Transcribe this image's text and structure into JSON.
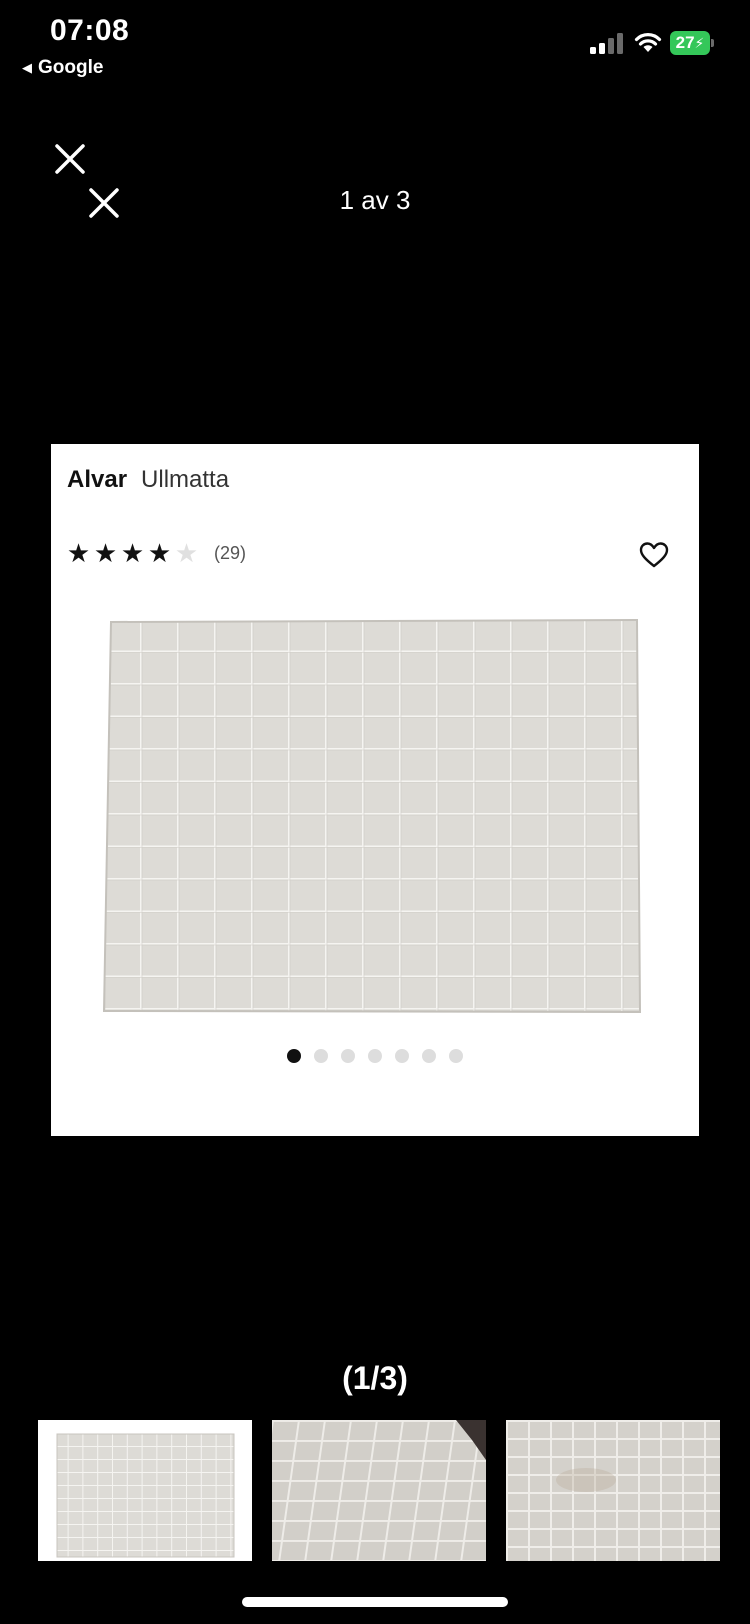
{
  "status_bar": {
    "time": "07:08",
    "back_label": "Google",
    "battery": "27"
  },
  "viewer": {
    "counter_top": "1 av 3",
    "counter_bottom": "(1/3)"
  },
  "product": {
    "brand": "Alvar",
    "name": "Ullmatta",
    "rating": 4,
    "max_rating": 5,
    "review_count": "(29)"
  },
  "carousel": {
    "dot_count": 7,
    "active_dot": 0
  },
  "thumbnails": [
    "rug-full-view",
    "rug-closeup-1",
    "rug-closeup-2"
  ],
  "colors": {
    "background": "#000000",
    "card": "#ffffff",
    "rug": "#dcdad5",
    "battery": "#34c759"
  }
}
